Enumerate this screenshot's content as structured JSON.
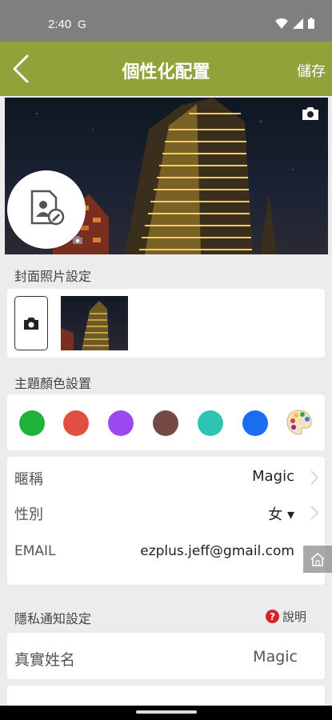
{
  "status_bar": {
    "time": "2:40",
    "g_icon": "G"
  },
  "app_bar": {
    "title": "個性化配置",
    "save_label": "儲存"
  },
  "cover": {
    "section_label": "封面照片設定"
  },
  "theme": {
    "section_label": "主題顏色設置",
    "colors": [
      "#1fb33d",
      "#e04f3f",
      "#9b48f0",
      "#744845",
      "#2fc4b2",
      "#1c6cf2"
    ]
  },
  "profile": {
    "nickname_label": "暱稱",
    "nickname_value": "Magic",
    "gender_label": "性別",
    "gender_value": "女 ▾",
    "email_label": "EMAIL",
    "email_value": "ezplus.jeff@gmail.com"
  },
  "privacy": {
    "section_label": "隱私通知設定",
    "help_label": "說明",
    "real_name_label": "真實姓名",
    "real_name_value": "Magic"
  }
}
